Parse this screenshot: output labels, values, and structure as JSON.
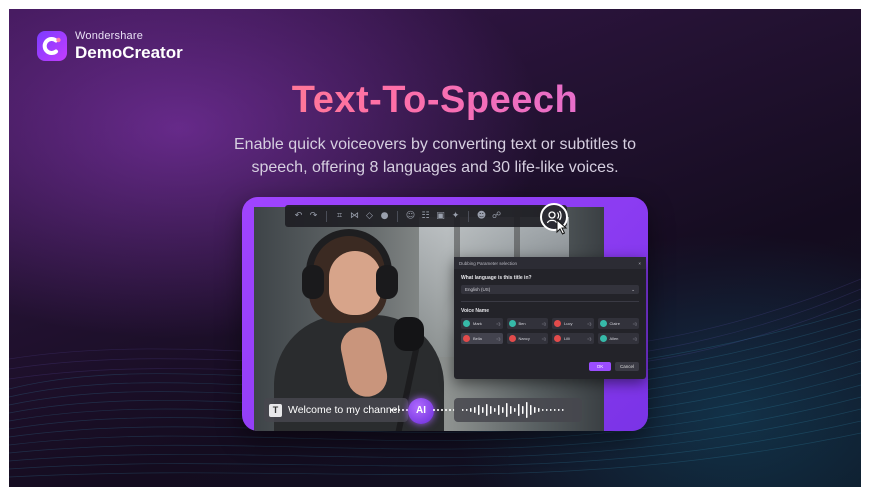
{
  "brand": {
    "company": "Wondershare",
    "product": "DemoCreator"
  },
  "headline": "Text-To-Speech",
  "description": {
    "line1": "Enable quick voiceovers by converting text or subtitles to",
    "line2": "speech, offering 8 languages and 30 life-like voices."
  },
  "toolbar": {
    "icons": [
      "undo-icon",
      "redo-icon",
      "crop-icon",
      "split-icon",
      "shield-icon",
      "mic-icon",
      "person-icon",
      "group-icon",
      "sticker-icon",
      "ai-icon",
      "emoji-icon",
      "people-icon",
      "text-to-speech-icon"
    ]
  },
  "dialog": {
    "title": "Dubbing Parameter selection",
    "close": "×",
    "language_question": "What language is this title in?",
    "language_value": "English (US)",
    "voice_section": "Voice Name",
    "voices": [
      {
        "name": "Mark",
        "color": "#36b9a8"
      },
      {
        "name": "Ben",
        "color": "#36b9a8"
      },
      {
        "name": "Lucy",
        "color": "#e24b4b"
      },
      {
        "name": "Claire",
        "color": "#36b9a8"
      },
      {
        "name": "Bella",
        "color": "#e24b4b"
      },
      {
        "name": "Nancy",
        "color": "#e24b4b"
      },
      {
        "name": "Lilli",
        "color": "#e24b4b"
      },
      {
        "name": "Allen",
        "color": "#36b9a8"
      }
    ],
    "ok_label": "OK",
    "cancel_label": "Cancel"
  },
  "caption": {
    "icon_letter": "T",
    "text": "Welcome to my channel"
  },
  "ai_badge": "AI",
  "colors": {
    "accent": "#9b4dff",
    "card": "#8c3cf2",
    "background": "#1a0f26"
  }
}
